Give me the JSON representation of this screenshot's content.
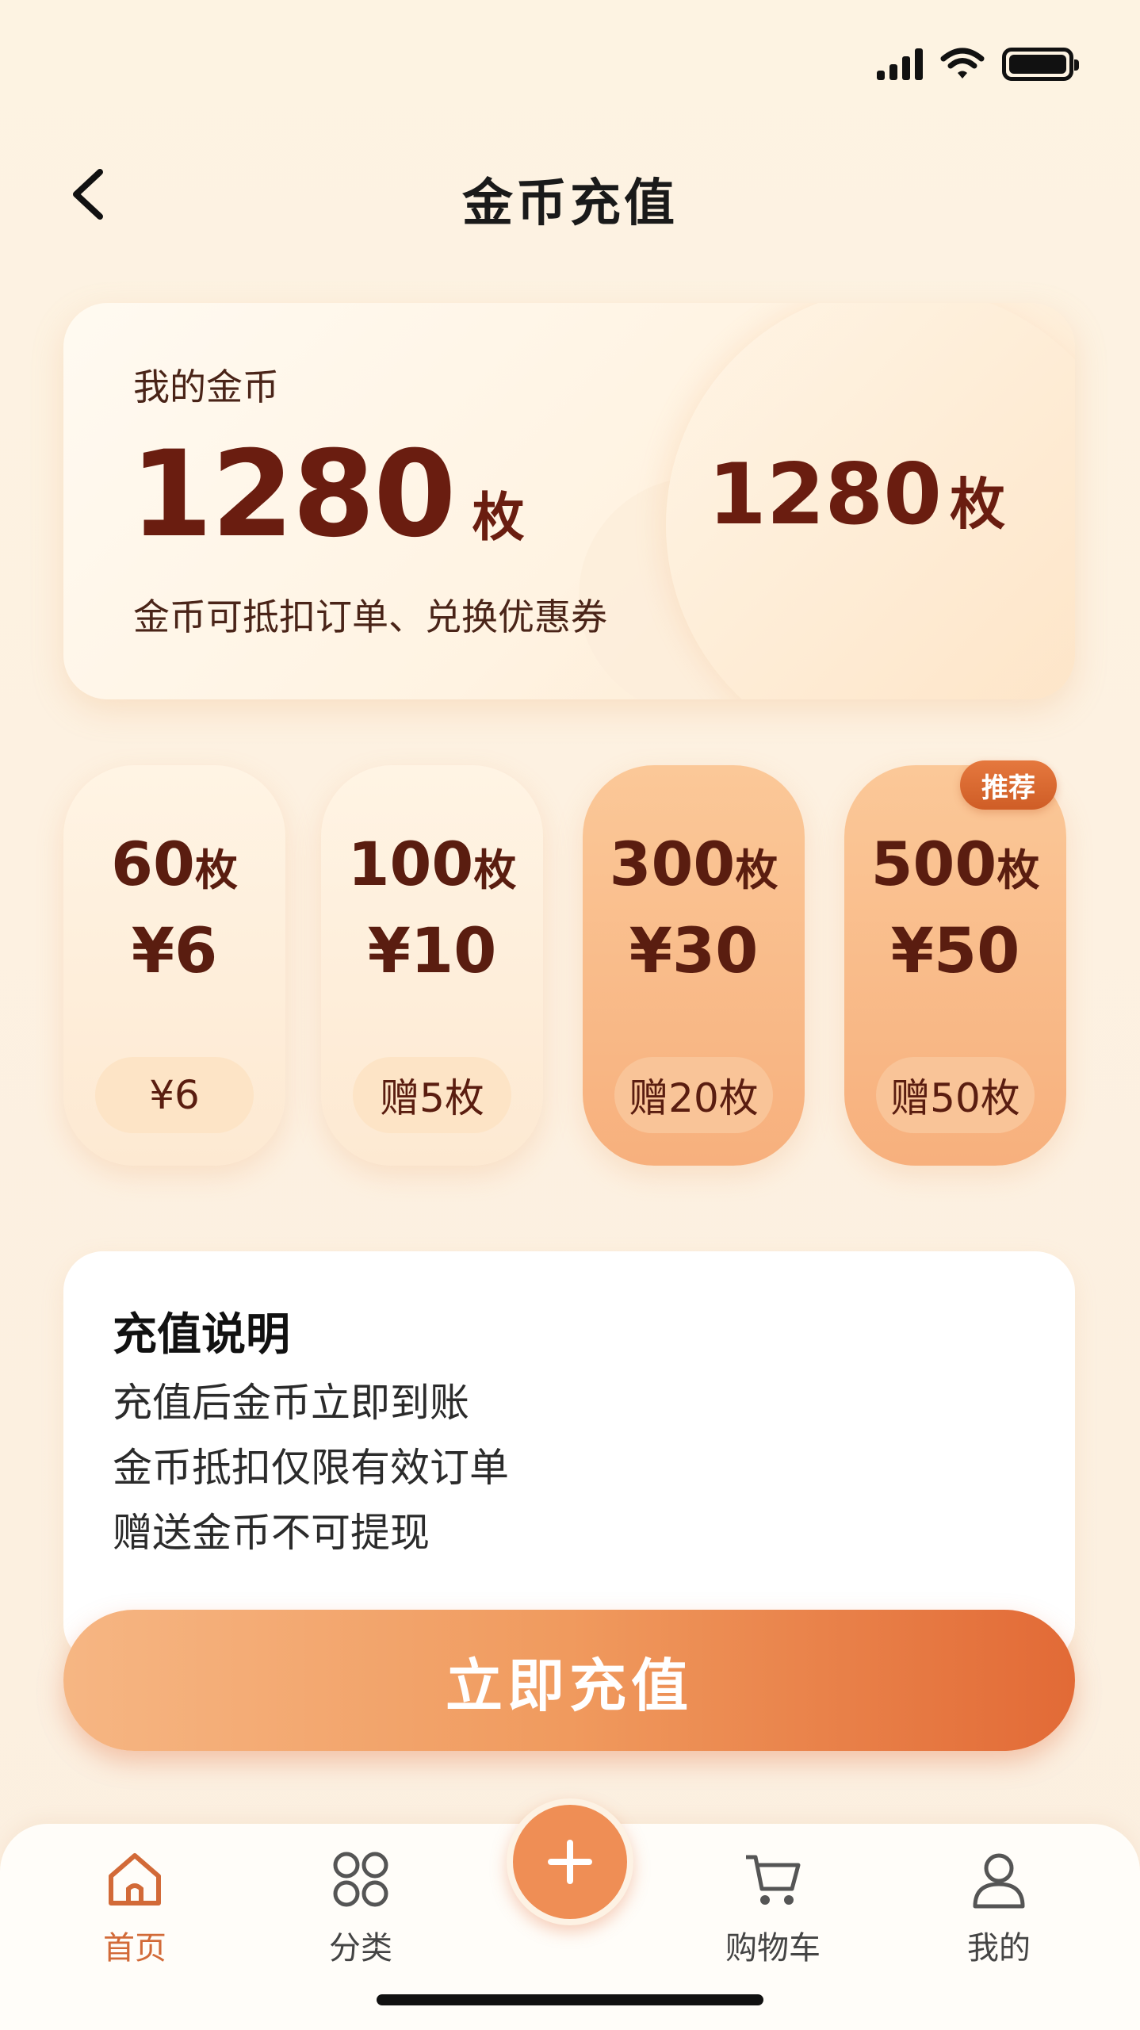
{
  "header": {
    "title": "金币充值"
  },
  "balance": {
    "label": "我的金币",
    "amount": "1280",
    "unit": "枚",
    "description": "金币可抵扣订单、兑换优惠券",
    "side_amount": "1280",
    "side_unit": "枚"
  },
  "packages": [
    {
      "coins": "60",
      "unit": "枚",
      "price": "¥6",
      "bonus": "¥6"
    },
    {
      "coins": "100",
      "unit": "枚",
      "price": "¥10",
      "bonus": "赠5枚"
    },
    {
      "coins": "300",
      "unit": "枚",
      "price": "¥30",
      "bonus": "赠20枚"
    },
    {
      "coins": "500",
      "unit": "枚",
      "price": "¥50",
      "bonus": "赠50枚",
      "badge": "推荐"
    }
  ],
  "notes": {
    "title": "充值说明",
    "items": [
      "充值后金币立即到账",
      "金币抵扣仅限有效订单",
      "赠送金币不可提现"
    ]
  },
  "recharge_button": "立即充值",
  "tabbar": {
    "items": [
      {
        "label": "首页",
        "icon": "home-icon"
      },
      {
        "label": "分类",
        "icon": "grid-icon"
      },
      {
        "label": "",
        "icon": "plus-icon"
      },
      {
        "label": "购物车",
        "icon": "cart-icon"
      },
      {
        "label": "我的",
        "icon": "user-icon"
      }
    ]
  },
  "colors": {
    "accent": "#ef8e55",
    "text_dark": "#6a1d10",
    "badge": "#d6652e"
  }
}
